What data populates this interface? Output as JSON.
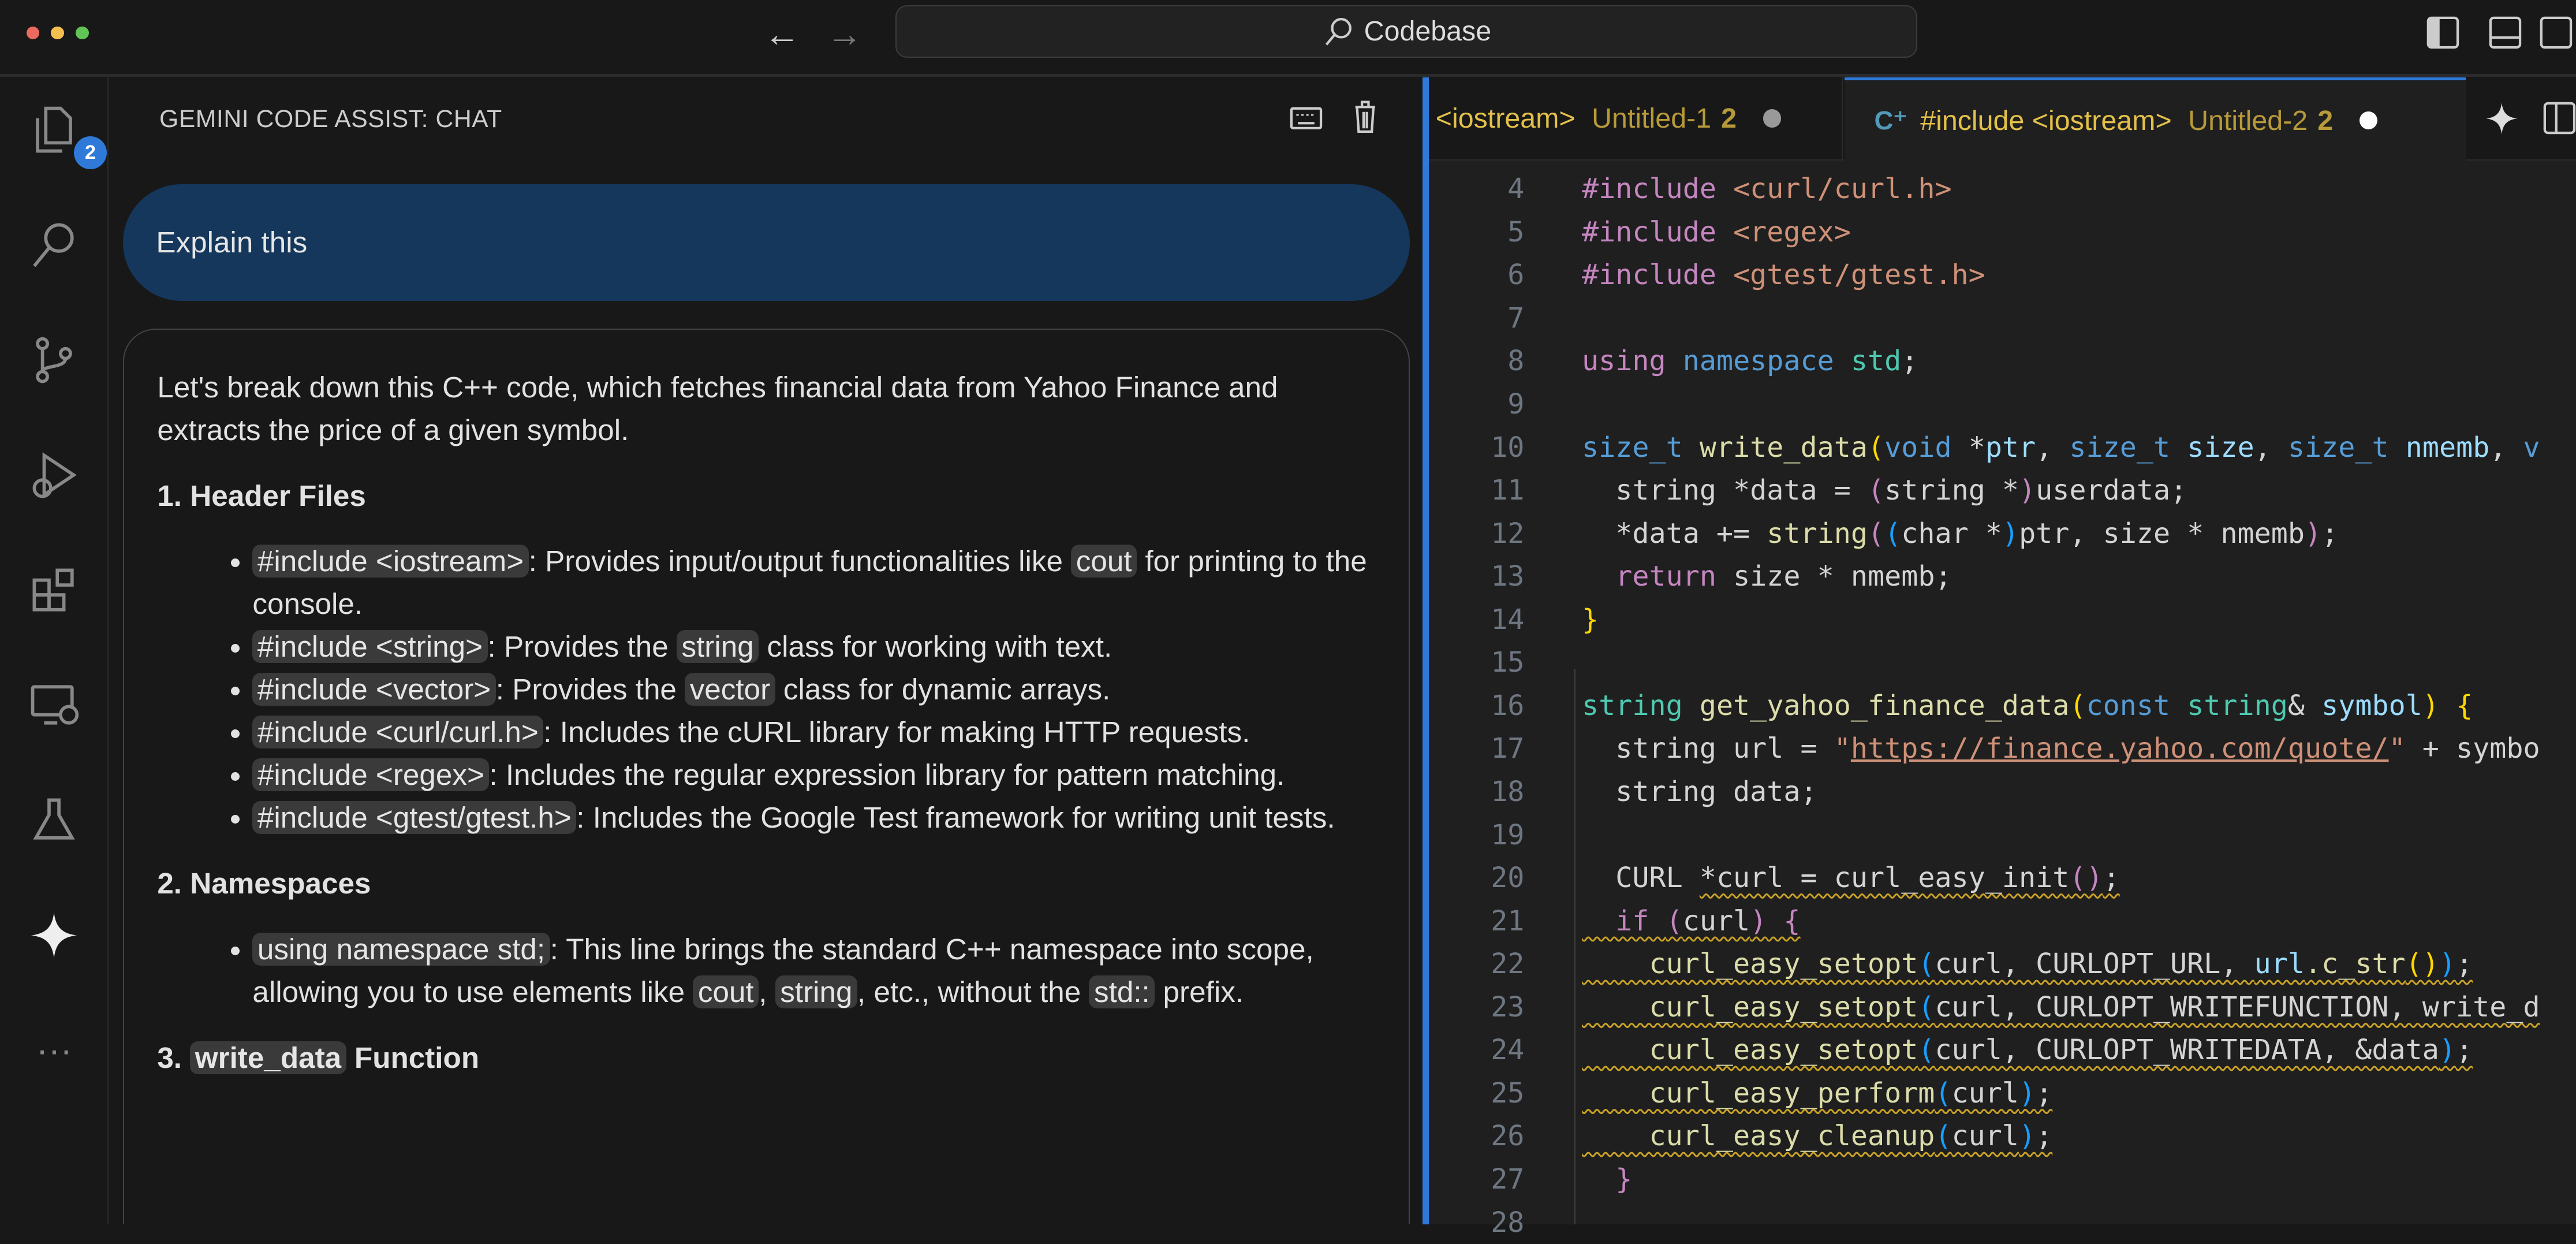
{
  "titlebar": {
    "search_label": "Codebase",
    "traffic_colors": [
      "#ed6a5e",
      "#f5bf4f",
      "#61c454"
    ]
  },
  "activity": {
    "explorer_badge": "2",
    "items": [
      "files-icon",
      "search-icon",
      "source-control-icon",
      "run-debug-icon",
      "extensions-icon",
      "remote-explorer-icon",
      "testing-icon",
      "gemini-sparkle-icon",
      "more-icon"
    ]
  },
  "chat": {
    "title": "GEMINI CODE ASSIST: CHAT",
    "user_message": "Explain this",
    "response": {
      "intro": "Let's break down this C++ code, which fetches financial data from Yahoo Finance and extracts the price of a given symbol.",
      "sections": [
        {
          "heading": [
            {
              "t": "1. Header Files"
            }
          ],
          "items": [
            [
              {
                "c": "#include <iostream>"
              },
              {
                "t": ": Provides input/output functionalities like "
              },
              {
                "c": "cout"
              },
              {
                "t": " for printing to the console."
              }
            ],
            [
              {
                "c": "#include <string>"
              },
              {
                "t": ": Provides the "
              },
              {
                "c": "string"
              },
              {
                "t": " class for working with text."
              }
            ],
            [
              {
                "c": "#include <vector>"
              },
              {
                "t": ": Provides the "
              },
              {
                "c": "vector"
              },
              {
                "t": " class for dynamic arrays."
              }
            ],
            [
              {
                "c": "#include <curl/curl.h>"
              },
              {
                "t": ": Includes the cURL library for making HTTP requests."
              }
            ],
            [
              {
                "c": "#include <regex>"
              },
              {
                "t": ": Includes the regular expression library for pattern matching."
              }
            ],
            [
              {
                "c": "#include <gtest/gtest.h>"
              },
              {
                "t": ": Includes the Google Test framework for writing unit tests."
              }
            ]
          ]
        },
        {
          "heading": [
            {
              "t": "2. Namespaces"
            }
          ],
          "items": [
            [
              {
                "c": "using namespace std;"
              },
              {
                "t": ": This line brings the standard C++ namespace into scope, allowing you to use elements like "
              },
              {
                "c": "cout"
              },
              {
                "t": ", "
              },
              {
                "c": "string"
              },
              {
                "t": ", etc., without the "
              },
              {
                "c": "std::"
              },
              {
                "t": " prefix."
              }
            ]
          ]
        },
        {
          "heading": [
            {
              "t": "3. "
            },
            {
              "c": "write_data"
            },
            {
              "t": " Function"
            }
          ],
          "items": []
        }
      ]
    }
  },
  "editor": {
    "tabs": [
      {
        "label": "<iostream>",
        "file": "Untitled-1",
        "problems": "2",
        "active": false
      },
      {
        "label": "#include <iostream>",
        "file": "Untitled-2",
        "problems": "2",
        "active": true
      }
    ],
    "lines": [
      {
        "n": "4",
        "tokens": [
          [
            "#include ",
            "k"
          ],
          [
            "<curl/curl.h>",
            "s"
          ]
        ]
      },
      {
        "n": "5",
        "tokens": [
          [
            "#include ",
            "k"
          ],
          [
            "<regex>",
            "s"
          ]
        ]
      },
      {
        "n": "6",
        "tokens": [
          [
            "#include ",
            "k"
          ],
          [
            "<gtest/gtest.h>",
            "s"
          ]
        ]
      },
      {
        "n": "7",
        "tokens": []
      },
      {
        "n": "8",
        "tokens": [
          [
            "using ",
            "k"
          ],
          [
            "namespace ",
            "t"
          ],
          [
            "std",
            "n"
          ],
          [
            ";",
            "d"
          ]
        ]
      },
      {
        "n": "9",
        "tokens": []
      },
      {
        "n": "10",
        "tokens": [
          [
            "size_t ",
            "t"
          ],
          [
            "write_data",
            "f"
          ],
          [
            "(",
            "y"
          ],
          [
            "void ",
            "t"
          ],
          [
            "*",
            "d"
          ],
          [
            "ptr",
            "v"
          ],
          [
            ", ",
            "d"
          ],
          [
            "size_t ",
            "t"
          ],
          [
            "size",
            "v"
          ],
          [
            ", ",
            "d"
          ],
          [
            "size_t ",
            "t"
          ],
          [
            "nmemb",
            "v"
          ],
          [
            ", ",
            "d"
          ],
          [
            "v",
            "t"
          ]
        ]
      },
      {
        "n": "11",
        "tokens": [
          [
            "  string ",
            "d"
          ],
          [
            "*",
            "d"
          ],
          [
            "data = ",
            "d"
          ],
          [
            "(",
            "k"
          ],
          [
            "string *",
            "d"
          ],
          [
            ")",
            "k"
          ],
          [
            "userdata;",
            "d"
          ]
        ]
      },
      {
        "n": "12",
        "tokens": [
          [
            "  *data += ",
            "d"
          ],
          [
            "string",
            "f"
          ],
          [
            "(",
            "k"
          ],
          [
            "(",
            "b"
          ],
          [
            "char *",
            "d"
          ],
          [
            ")",
            "b"
          ],
          [
            "ptr, size * nmemb",
            "d"
          ],
          [
            ")",
            "k"
          ],
          [
            ";",
            "d"
          ]
        ]
      },
      {
        "n": "13",
        "tokens": [
          [
            "  return ",
            "k"
          ],
          [
            "size * nmemb;",
            "d"
          ]
        ]
      },
      {
        "n": "14",
        "tokens": [
          [
            "}",
            "y"
          ]
        ]
      },
      {
        "n": "15",
        "tokens": []
      },
      {
        "n": "16",
        "tokens": [
          [
            "string ",
            "n"
          ],
          [
            "get_yahoo_finance_data",
            "f"
          ],
          [
            "(",
            "y"
          ],
          [
            "const ",
            "t"
          ],
          [
            "string",
            "n"
          ],
          [
            "& ",
            "d"
          ],
          [
            "symbol",
            "v"
          ],
          [
            ") ",
            "y"
          ],
          [
            "{",
            "y"
          ]
        ]
      },
      {
        "n": "17",
        "tokens": [
          [
            "  string url = ",
            "d"
          ],
          [
            "\"",
            "s"
          ],
          [
            "https://finance.yahoo.com/quote/",
            "u"
          ],
          [
            "\"",
            "s"
          ],
          [
            " + symbo",
            "d"
          ]
        ]
      },
      {
        "n": "18",
        "tokens": [
          [
            "  string data;",
            "d"
          ]
        ]
      },
      {
        "n": "19",
        "tokens": []
      },
      {
        "n": "20",
        "tokens": [
          [
            "  CURL ",
            "d"
          ],
          [
            "*curl = curl_easy_init",
            "dw"
          ],
          [
            "()",
            "kw"
          ],
          [
            ";",
            "dw"
          ]
        ]
      },
      {
        "n": "21",
        "tokens": [
          [
            "  if ",
            "kw"
          ],
          [
            "(",
            "kw"
          ],
          [
            "curl",
            "dw"
          ],
          [
            ")",
            "kw"
          ],
          [
            " {",
            "kw"
          ]
        ]
      },
      {
        "n": "22",
        "tokens": [
          [
            "    curl_easy_setopt",
            "fw"
          ],
          [
            "(",
            "bw"
          ],
          [
            "curl, CURLOPT_URL, ",
            "dw"
          ],
          [
            "url",
            "vw"
          ],
          [
            ".c_str",
            "fw"
          ],
          [
            "()",
            "yw"
          ],
          [
            ")",
            "bw"
          ],
          [
            ";",
            "dw"
          ]
        ]
      },
      {
        "n": "23",
        "tokens": [
          [
            "    curl_easy_setopt",
            "fw"
          ],
          [
            "(",
            "bw"
          ],
          [
            "curl, CURLOPT_WRITEFUNCTION, write_d",
            "dw"
          ]
        ]
      },
      {
        "n": "24",
        "tokens": [
          [
            "    curl_easy_setopt",
            "fw"
          ],
          [
            "(",
            "bw"
          ],
          [
            "curl, CURLOPT_WRITEDATA, &data",
            "dw"
          ],
          [
            ")",
            "bw"
          ],
          [
            ";",
            "dw"
          ]
        ]
      },
      {
        "n": "25",
        "tokens": [
          [
            "    curl_easy_perform",
            "fw"
          ],
          [
            "(",
            "bw"
          ],
          [
            "curl",
            "dw"
          ],
          [
            ")",
            "bw"
          ],
          [
            ";",
            "dw"
          ]
        ]
      },
      {
        "n": "26",
        "tokens": [
          [
            "    curl_easy_cleanup",
            "fw"
          ],
          [
            "(",
            "bw"
          ],
          [
            "curl",
            "dw"
          ],
          [
            ")",
            "bw"
          ],
          [
            ";",
            "dw"
          ]
        ]
      },
      {
        "n": "27",
        "tokens": [
          [
            "  }",
            "k"
          ]
        ]
      },
      {
        "n": "28",
        "tokens": []
      }
    ]
  }
}
